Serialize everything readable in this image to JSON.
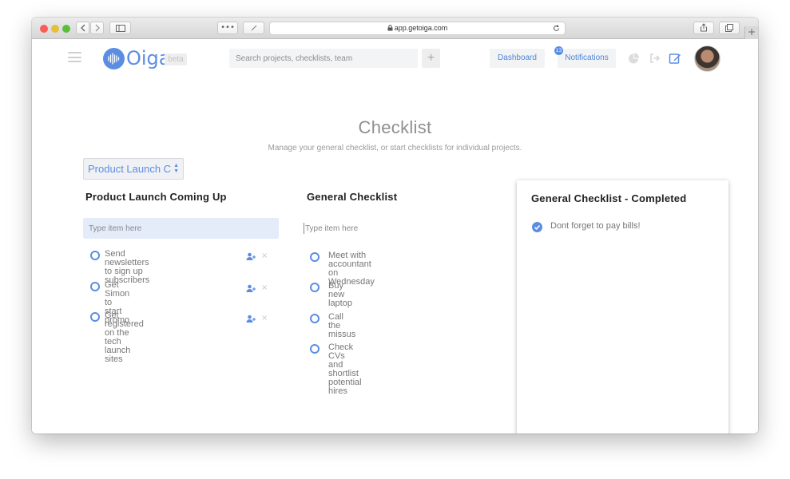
{
  "browser": {
    "url": "app.getoiga.com",
    "colors": {
      "close": "#fc5b57",
      "minimize": "#e5bf3c",
      "maximize": "#57c038"
    },
    "tab_more": "•••",
    "new_tab": "+"
  },
  "header": {
    "logo_text": "Oiga",
    "beta_label": "beta",
    "search_placeholder": "Search projects, checklists, team",
    "add_label": "+",
    "dashboard_label": "Dashboard",
    "notifications_label": "Notifications",
    "notifications_count": "13",
    "accent_color": "#5b8de3"
  },
  "page": {
    "title": "Checklist",
    "subtitle": "Manage your general checklist, or start checklists for individual projects."
  },
  "project_selector": {
    "selected": "Product Launch C"
  },
  "columns": {
    "project": {
      "title": "Product Launch Coming Up",
      "input_placeholder": "Type item here",
      "items": [
        {
          "text_line1": "Send newsletters to sign up",
          "text_line2": "subscribers"
        },
        {
          "text_line1": "Get Simon to start promo",
          "text_line2": ""
        },
        {
          "text_line1": "Get registered on the tech launch",
          "text_line2": "sites"
        }
      ]
    },
    "general": {
      "title": "General Checklist",
      "input_placeholder": "Type item here",
      "items": [
        {
          "text_line1": "Meet with accountant on Wednesday",
          "text_line2": ""
        },
        {
          "text_line1": "Buy new laptop",
          "text_line2": ""
        },
        {
          "text_line1": "Call the missus",
          "text_line2": ""
        },
        {
          "text_line1": "Check CVs and shortlist potential",
          "text_line2": "hires"
        }
      ]
    },
    "completed": {
      "title": "General Checklist - Completed",
      "items": [
        {
          "text": "Dont forget to pay bills!"
        }
      ]
    }
  },
  "icons": {
    "remove": "×",
    "select_up": "▲",
    "select_down": "▼"
  }
}
